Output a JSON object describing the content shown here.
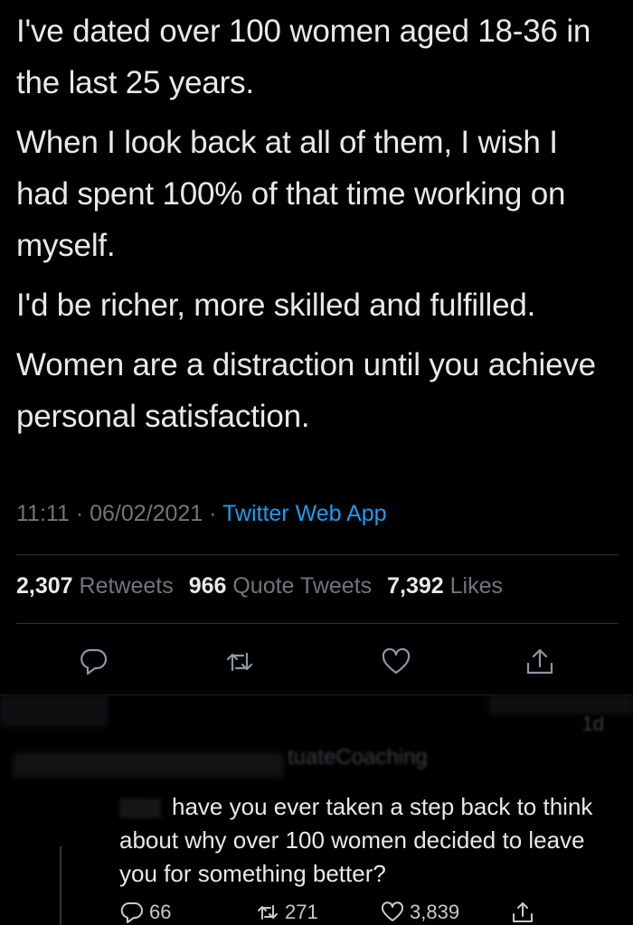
{
  "tweet": {
    "paragraphs": [
      "I've dated over 100 women aged 18-36 in the last 25 years.",
      "When I look back at all of them, I wish I had spent 100% of that time working on myself.",
      "I'd be richer, more skilled and fulfilled.",
      "Women are a distraction until you achieve personal satisfaction."
    ],
    "time": "11:11",
    "date": "06/02/2021",
    "separator": "·",
    "source": "Twitter Web App"
  },
  "stats": {
    "retweets_count": "2,307",
    "retweets_label": "Retweets",
    "quotes_count": "966",
    "quotes_label": "Quote Tweets",
    "likes_count": "7,392",
    "likes_label": "Likes"
  },
  "actions": {
    "icons": [
      "reply-icon",
      "retweet-icon",
      "like-icon",
      "share-icon"
    ]
  },
  "reply": {
    "time_ago": "1d",
    "handle_partial": "tuateCoaching",
    "text": "have you ever taken a step back to think about why over 100 women decided to leave you for something better?",
    "reply_count": "66",
    "retweet_count": "271",
    "like_count": "3,839"
  },
  "colors": {
    "background": "#000000",
    "text": "#e7e9ea",
    "muted": "#71767b",
    "link": "#1d9bf0",
    "divider": "#2f3336"
  }
}
